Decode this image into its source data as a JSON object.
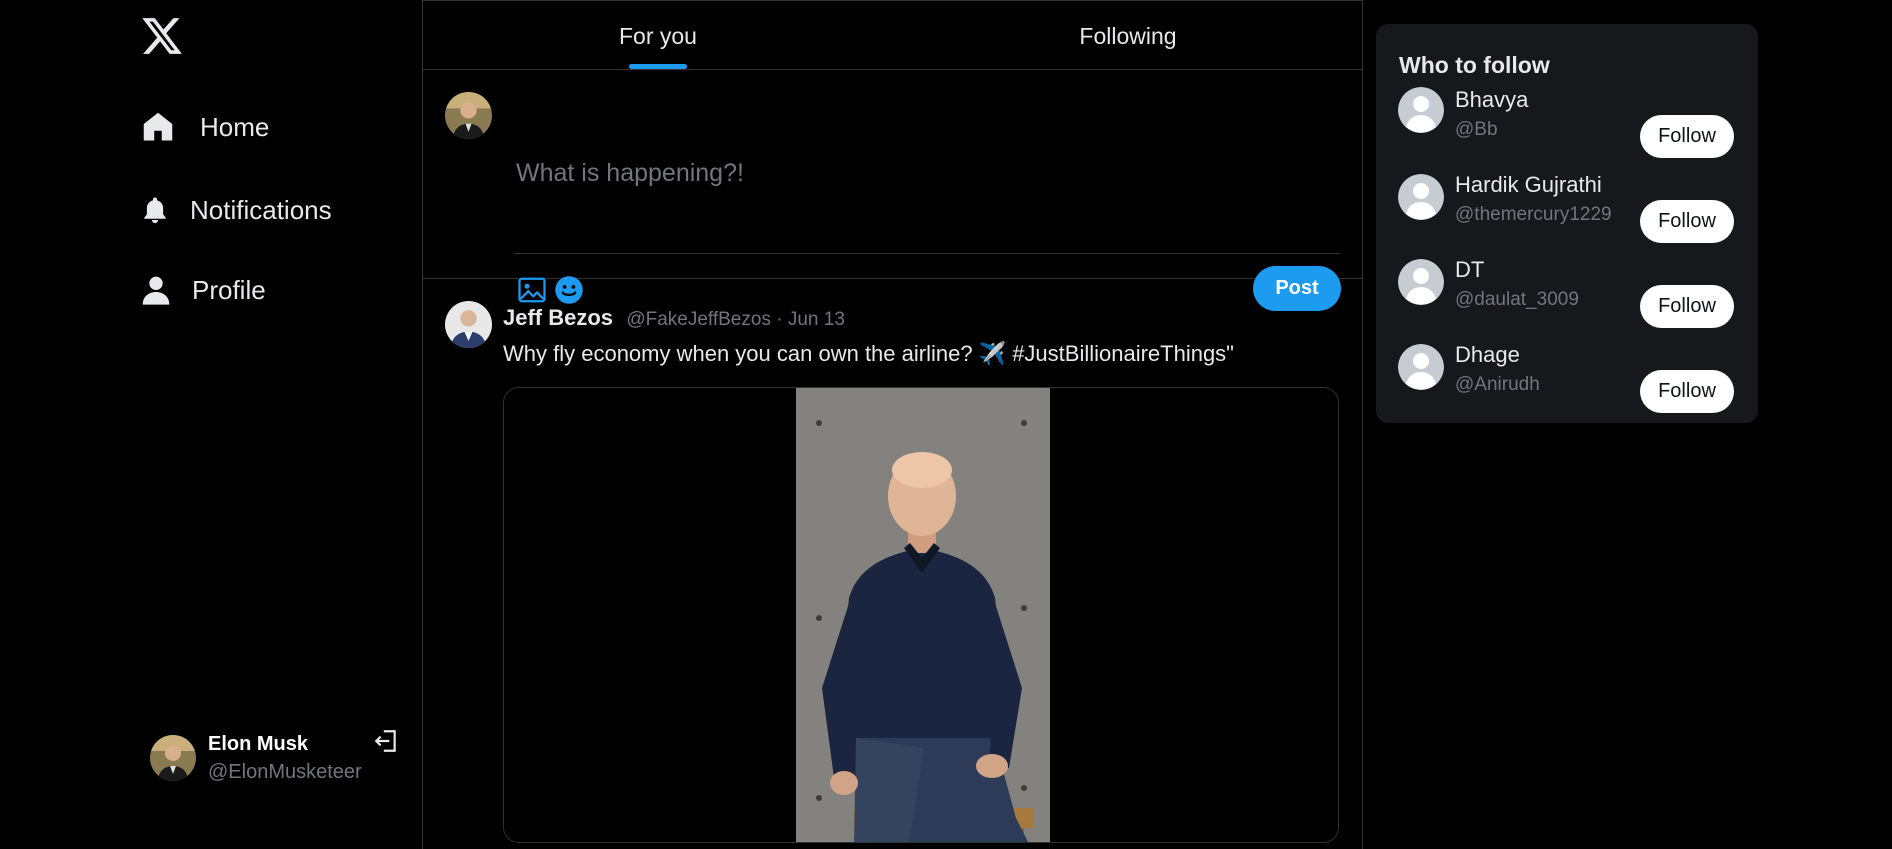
{
  "app": {
    "logo_icon": "x-logo-icon"
  },
  "sidebar": {
    "items": [
      {
        "label": "Home",
        "icon": "home-icon"
      },
      {
        "label": "Notifications",
        "icon": "bell-icon"
      },
      {
        "label": "Profile",
        "icon": "user-icon"
      }
    ],
    "account": {
      "name": "Elon Musk",
      "handle": "@ElonMusketeer",
      "logout_icon": "logout-icon"
    }
  },
  "main": {
    "tabs": [
      {
        "label": "For you",
        "active": true
      },
      {
        "label": "Following",
        "active": false
      }
    ],
    "composer": {
      "placeholder": "What is happening?!",
      "value": "",
      "post_label": "Post",
      "icons": [
        "image-icon",
        "emoji-icon"
      ]
    },
    "tweets": [
      {
        "name": "Jeff Bezos",
        "handle": "@FakeJeffBezos",
        "separator": "·",
        "date": "Jun 13",
        "text": "Why fly economy when you can own the airline? ✈️ #JustBillionaireThings\""
      }
    ]
  },
  "right": {
    "who_to_follow": {
      "title": "Who to follow",
      "users": [
        {
          "name": "Bhavya",
          "handle": "@Bb",
          "button": "Follow"
        },
        {
          "name": "Hardik Gujrathi",
          "handle": "@themercury1229",
          "button": "Follow"
        },
        {
          "name": "DT",
          "handle": "@daulat_3009",
          "button": "Follow"
        },
        {
          "name": "Dhage",
          "handle": "@Anirudh",
          "button": "Follow"
        }
      ]
    }
  },
  "colors": {
    "background": "#000000",
    "accent": "#1d9bf0",
    "card": "#16181c",
    "muted_text": "#71767b",
    "border": "#2f3336"
  }
}
